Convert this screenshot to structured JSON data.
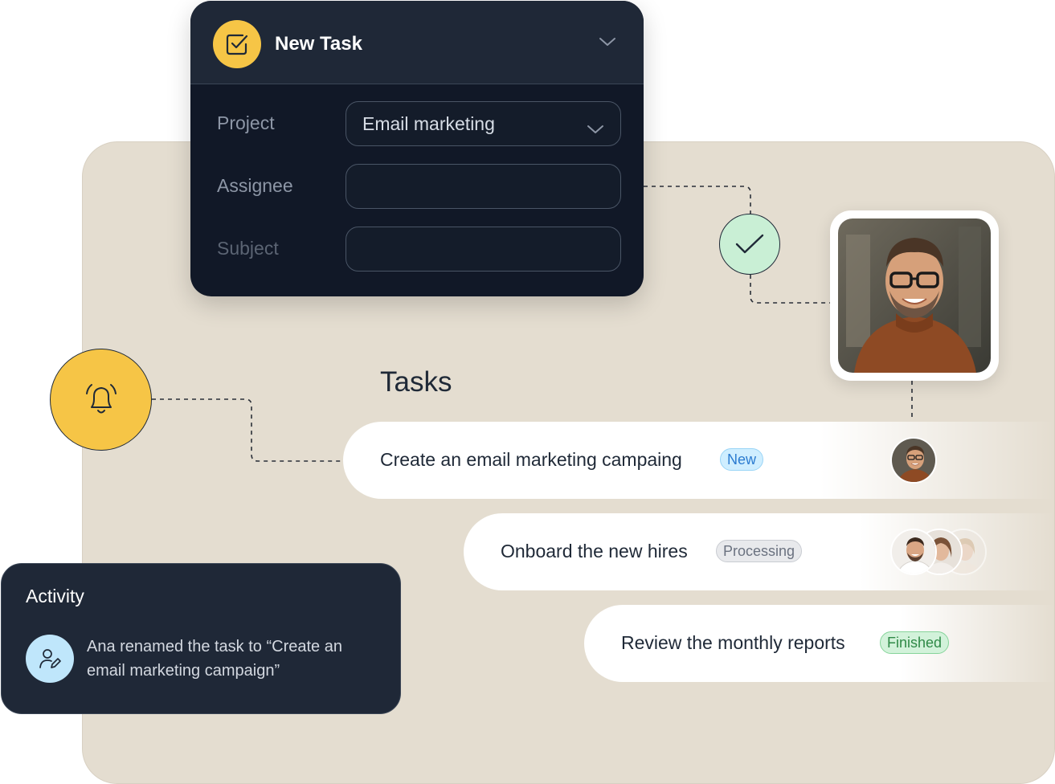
{
  "new_task": {
    "title": "New Task",
    "fields": {
      "project_label": "Project",
      "project_value": "Email marketing",
      "assignee_label": "Assignee",
      "assignee_value": "",
      "subject_label": "Subject",
      "subject_value": ""
    }
  },
  "tasks": {
    "heading": "Tasks",
    "items": [
      {
        "title": "Create an email marketing campaing",
        "status": "New"
      },
      {
        "title": "Onboard the new hires",
        "status": "Processing"
      },
      {
        "title": "Review the monthly reports",
        "status": "Finished"
      }
    ]
  },
  "activity": {
    "title": "Activity",
    "message": "Ana renamed the task to “Create an email marketing campaign”"
  },
  "icons": {
    "task": "checkbox-square-icon",
    "collapse": "chevron-down-icon",
    "done": "checkmark-icon",
    "notification": "bell-icon",
    "activity": "user-edit-icon"
  },
  "colors": {
    "accent_yellow": "#f6c546",
    "dark_card": "#111827",
    "panel_beige": "#e4ddd0",
    "success_green": "#c9efd5",
    "info_blue": "#bfe6fb"
  }
}
